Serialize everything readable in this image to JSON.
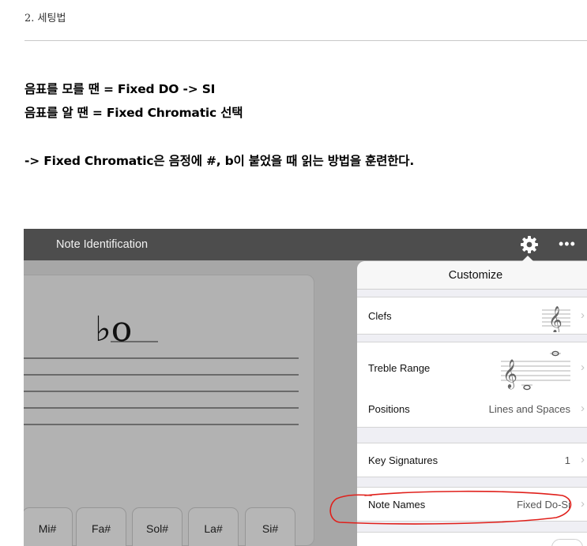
{
  "document": {
    "section_title": "2. 세팅법",
    "line1": "음표를 모를 땐 = Fixed DO -> SI",
    "line2": "음표를 알 땐 = Fixed Chromatic 선택",
    "line3": "-> Fixed Chromatic은 음정에 #, b이 붙었을 때 읽는 방법을 훈련한다."
  },
  "app": {
    "title": "Note Identification",
    "icons": {
      "settings": "gear-icon",
      "more": "more-icon"
    },
    "more_glyph": "•••",
    "note_glyph": "♭o",
    "note_buttons": [
      "Mi#",
      "Fa#",
      "Sol#",
      "La#",
      "Si#"
    ],
    "customize": {
      "title": "Customize",
      "rows": [
        {
          "label": "Clefs",
          "value": ""
        },
        {
          "label": "Treble Range",
          "value": ""
        },
        {
          "label": "Positions",
          "value": "Lines and Spaces"
        },
        {
          "label": "Key Signatures",
          "value": "1"
        },
        {
          "label": "Note Names",
          "value": "Fixed Do-Si"
        }
      ],
      "chevron": "›"
    }
  },
  "colors": {
    "annotation": "#e0201b",
    "app_bar": "#4d4d4d",
    "app_bg": "#a7a7a7"
  }
}
